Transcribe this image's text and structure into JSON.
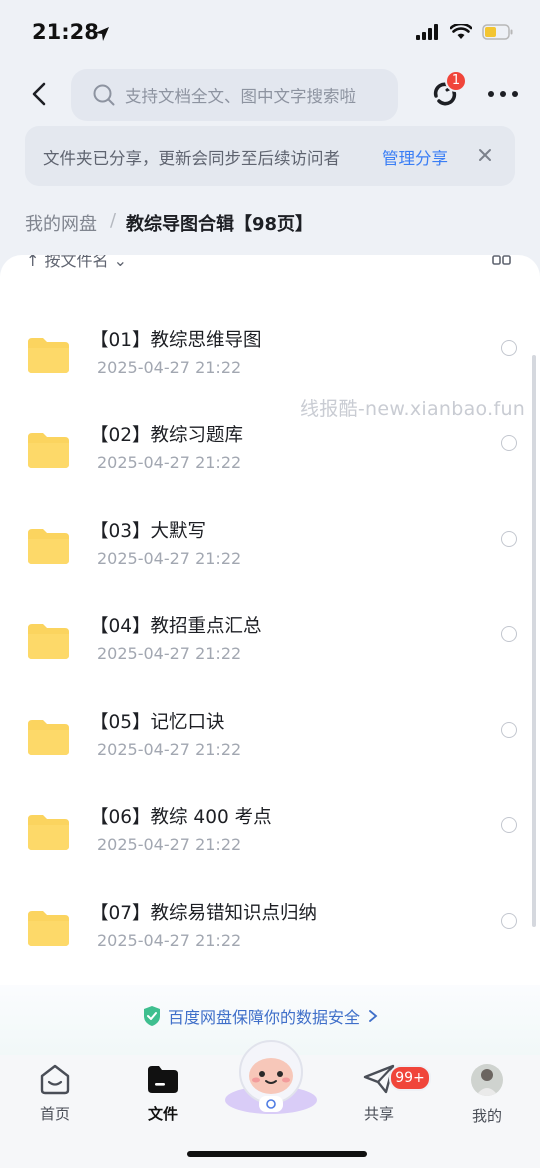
{
  "status_bar": {
    "time": "21:28"
  },
  "search": {
    "placeholder": "支持文档全文、图中文字搜索啦"
  },
  "sync_badge": "1",
  "notice": {
    "text": "文件夹已分享，更新会同步至后续访问者",
    "action": "管理分享"
  },
  "breadcrumb": {
    "root": "我的网盘",
    "separator": "/",
    "current": "教综导图合辑【98页】"
  },
  "list": {
    "sort_label": "↑ 按文件名 ⌄",
    "items": [
      {
        "name": "【01】教综思维导图",
        "date": "2025-04-27 21:22"
      },
      {
        "name": "【02】教综习题库",
        "date": "2025-04-27 21:22"
      },
      {
        "name": "【03】大默写",
        "date": "2025-04-27 21:22"
      },
      {
        "name": "【04】教招重点汇总",
        "date": "2025-04-27 21:22"
      },
      {
        "name": "【05】记忆口诀",
        "date": "2025-04-27 21:22"
      },
      {
        "name": "【06】教综 400 考点",
        "date": "2025-04-27 21:22"
      },
      {
        "name": "【07】教综易错知识点归纳",
        "date": "2025-04-27 21:22"
      }
    ]
  },
  "watermark": "线报酷-new.xianbao.fun",
  "security_text": "百度网盘保障你的数据安全",
  "tabs": [
    {
      "label": "首页"
    },
    {
      "label": "文件"
    },
    {
      "label": "共享",
      "badge": "99+"
    },
    {
      "label": "我的"
    }
  ],
  "colors": {
    "accent": "#3a7ef5",
    "badge": "#f0453a",
    "folder": "#fbd45f"
  }
}
